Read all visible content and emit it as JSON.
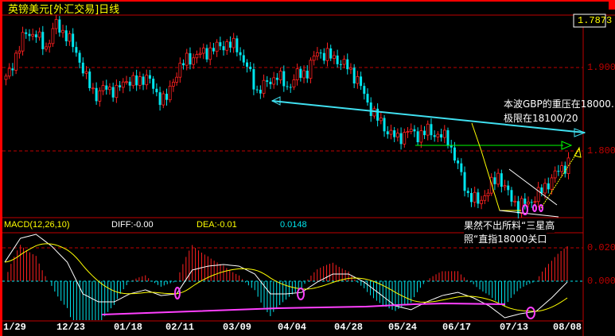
{
  "title": "英镑美元[外汇交易]日线",
  "colors": {
    "up": "#ff2020",
    "down": "#00e5ee",
    "grid": "#c00000",
    "diff": "#ffffff",
    "dea": "#ffff00",
    "trend": "#40e0f0",
    "support": "#00ff00",
    "macd_support": "#ff40ff"
  },
  "price_axis": {
    "current": "1.7873",
    "levels": [
      "1.9000",
      "1.8000"
    ]
  },
  "macd_axis": {
    "levels": [
      "0.0200",
      "0.0000"
    ]
  },
  "macd_header": {
    "name": "MACD(12,26,10)",
    "diff": "DIFF:-0.00",
    "dea": "DEA:-0.01",
    "macd": "0.0148"
  },
  "annotations": {
    "resistance_1": "本波GBP的重压在18000.",
    "resistance_2": "极限在18100/20",
    "pattern_1": "果然不出所料“三星高",
    "pattern_2": "照“直指18000关口"
  },
  "chart_data": {
    "type": "candlestick",
    "x_ticks": [
      "1/29",
      "12/23",
      "01/18",
      "02/11",
      "03/09",
      "04/04",
      "04/28",
      "05/24",
      "06/17",
      "07/13",
      "08/08"
    ],
    "price_levels": [
      1.9,
      1.8
    ],
    "close_path": [
      1.8857,
      1.9143,
      1.9429,
      1.9381,
      1.9238,
      1.9524,
      1.9381,
      1.919,
      1.8857,
      1.8667,
      1.8762,
      1.8714,
      1.8857,
      1.881,
      1.8905,
      1.8667,
      1.8619,
      1.8952,
      1.9095,
      1.9143,
      1.919,
      1.9238,
      1.9286,
      1.9238,
      1.9,
      1.8714,
      1.881,
      1.8905,
      1.8762,
      1.8905,
      1.8952,
      1.919,
      1.9143,
      1.9095,
      1.9,
      1.8857,
      1.8571,
      1.8381,
      1.8238,
      1.8143,
      1.8238,
      1.819,
      1.8238,
      1.819,
      1.8143,
      1.781,
      1.7476,
      1.7381,
      1.7524,
      1.7714,
      1.7476,
      1.7333,
      1.7381,
      1.7476,
      1.7619,
      1.7762,
      1.7857
    ],
    "macd_diff_path": [
      0.0114,
      0.0257,
      0.0281,
      0.021,
      0.0114,
      -0.0076,
      -0.0124,
      -0.0124,
      -0.0076,
      -0.0052,
      -0.0086,
      -0.0076,
      0.0067,
      0.009,
      0.01,
      0.009,
      0.0043,
      -0.0076,
      -0.0076,
      -0.0067,
      -0.0005,
      0.0043,
      0.0043,
      -0.0005,
      -0.0076,
      -0.0148,
      -0.0171,
      -0.0124,
      -0.0086,
      -0.0067,
      -0.01,
      -0.0148,
      -0.0219,
      -0.0195,
      -0.0181,
      -0.01,
      -0.0005
    ]
  }
}
